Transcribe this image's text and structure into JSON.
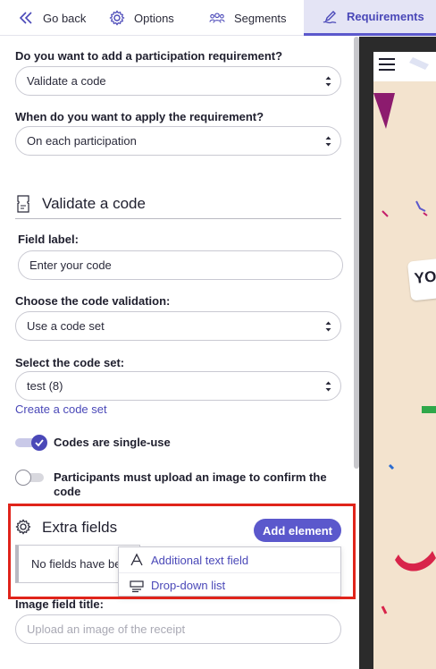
{
  "tabs": {
    "back": "Go back",
    "options": "Options",
    "segments": "Segments",
    "requirements": "Requirements"
  },
  "form": {
    "participation_q": "Do you want to add a participation requirement?",
    "participation_value": "Validate a code",
    "apply_q": "When do you want to apply the requirement?",
    "apply_value": "On each participation",
    "section_title": "Validate a code",
    "field_label_q": "Field label:",
    "field_label_value": "Enter your code",
    "validation_q": "Choose the code validation:",
    "validation_value": "Use a code set",
    "code_set_q": "Select the code set:",
    "code_set_value": "test (8)",
    "create_link": "Create a code set",
    "single_use_label": "Codes are single-use",
    "single_use_on": true,
    "upload_label": "Participants must upload an image to confirm the code",
    "upload_on": false
  },
  "extra_fields": {
    "title": "Extra fields",
    "add_button": "Add element",
    "empty_text": "No fields have been added",
    "menu": [
      "Additional text field",
      "Drop-down list"
    ]
  },
  "image_field": {
    "title": "Image field title:",
    "placeholder": "Upload an image of the receipt"
  },
  "preview": {
    "badge_text": "YO"
  },
  "colors": {
    "accent": "#5b58cc",
    "highlight": "#e0241b",
    "preview_bg": "#f3e3ce"
  }
}
